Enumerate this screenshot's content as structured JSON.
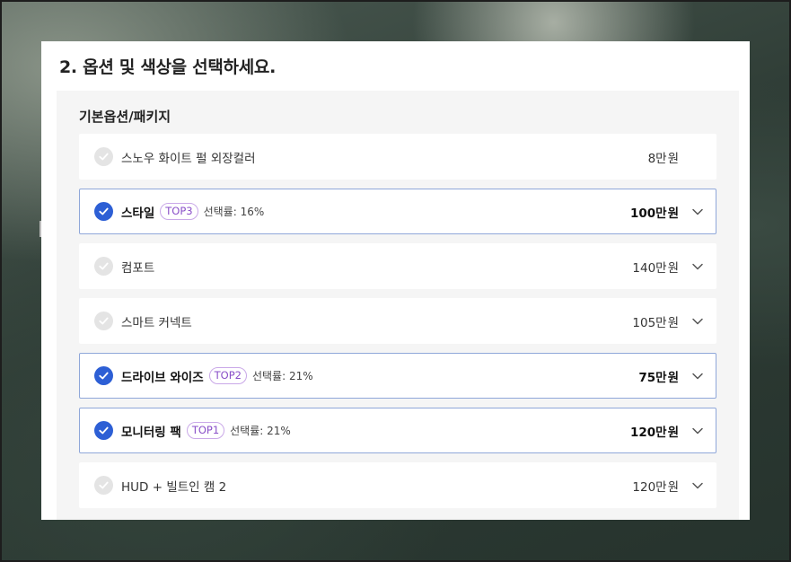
{
  "step": {
    "title": "2. 옵션 및 색상을 선택하세요."
  },
  "section": {
    "title": "기본옵션/패키지"
  },
  "options": [
    {
      "name": "스노우 화이트 펄 외장컬러",
      "badge": "",
      "rate": "",
      "price": "8만",
      "unit": "원",
      "selected": false,
      "expandable": false
    },
    {
      "name": "스타일",
      "badge": "TOP3",
      "rate": "선택률: 16%",
      "price": "100만",
      "unit": "원",
      "selected": true,
      "expandable": true
    },
    {
      "name": "컴포트",
      "badge": "",
      "rate": "",
      "price": "140만",
      "unit": "원",
      "selected": false,
      "expandable": true
    },
    {
      "name": "스마트 커넥트",
      "badge": "",
      "rate": "",
      "price": "105만",
      "unit": "원",
      "selected": false,
      "expandable": true
    },
    {
      "name": "드라이브 와이즈",
      "badge": "TOP2",
      "rate": "선택률: 21%",
      "price": "75만",
      "unit": "원",
      "selected": true,
      "expandable": true
    },
    {
      "name": "모니터링 팩",
      "badge": "TOP1",
      "rate": "선택률: 21%",
      "price": "120만",
      "unit": "원",
      "selected": true,
      "expandable": true
    },
    {
      "name": "HUD + 빌트인 캠 2",
      "badge": "",
      "rate": "",
      "price": "120만",
      "unit": "원",
      "selected": false,
      "expandable": true
    }
  ],
  "colors": {
    "accent": "#2d5fd5",
    "badge": "#8a50c8",
    "selected_border": "#8fa7d9"
  },
  "icons": {
    "check": "check-icon",
    "expand": "chevron-down-icon"
  }
}
